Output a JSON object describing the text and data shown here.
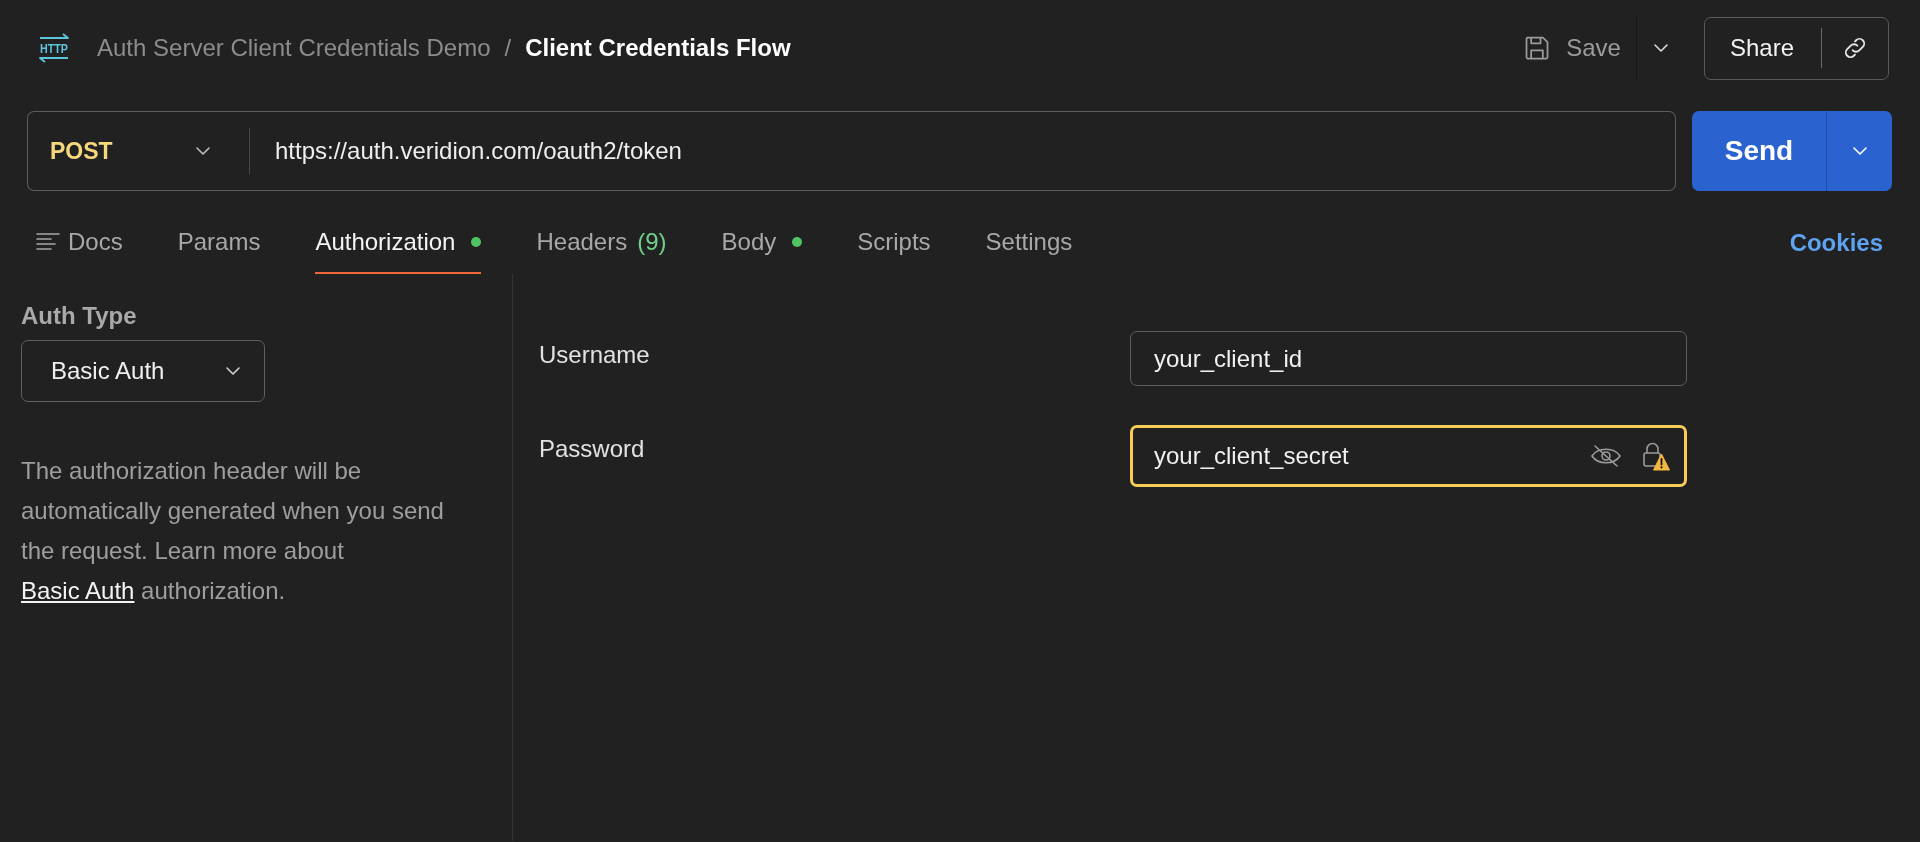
{
  "header": {
    "icon_text": "HTTP",
    "collection": "Auth Server Client Credentials Demo",
    "separator": "/",
    "request_name": "Client Credentials Flow",
    "save_button": "Save",
    "share_button": "Share"
  },
  "request": {
    "method": "POST",
    "url": "https://auth.veridion.com/oauth2/token",
    "send_button": "Send"
  },
  "tabs": [
    {
      "label": "Docs",
      "kind": "icon",
      "selected": false,
      "dot": false
    },
    {
      "label": "Params",
      "kind": "text",
      "selected": false,
      "dot": false
    },
    {
      "label": "Authorization",
      "kind": "text",
      "selected": true,
      "dot": true
    },
    {
      "label": "Headers",
      "kind": "text",
      "count": "(9)",
      "selected": false,
      "dot": false
    },
    {
      "label": "Body",
      "kind": "text",
      "selected": false,
      "dot": true
    },
    {
      "label": "Scripts",
      "kind": "text",
      "selected": false,
      "dot": false
    },
    {
      "label": "Settings",
      "kind": "text",
      "selected": false,
      "dot": false
    }
  ],
  "cookies_link": "Cookies",
  "auth": {
    "heading": "Auth Type",
    "type": "Basic Auth",
    "description": "The authorization header will be automatically generated when you send the request. Learn more about",
    "link": "Basic Auth",
    "description_end": "authorization."
  },
  "fields": [
    {
      "label": "Username",
      "value": "your_client_id",
      "kind": "text",
      "focused": false
    },
    {
      "label": "Password",
      "value": "your_client_secret",
      "kind": "secret",
      "focused": true
    }
  ]
}
